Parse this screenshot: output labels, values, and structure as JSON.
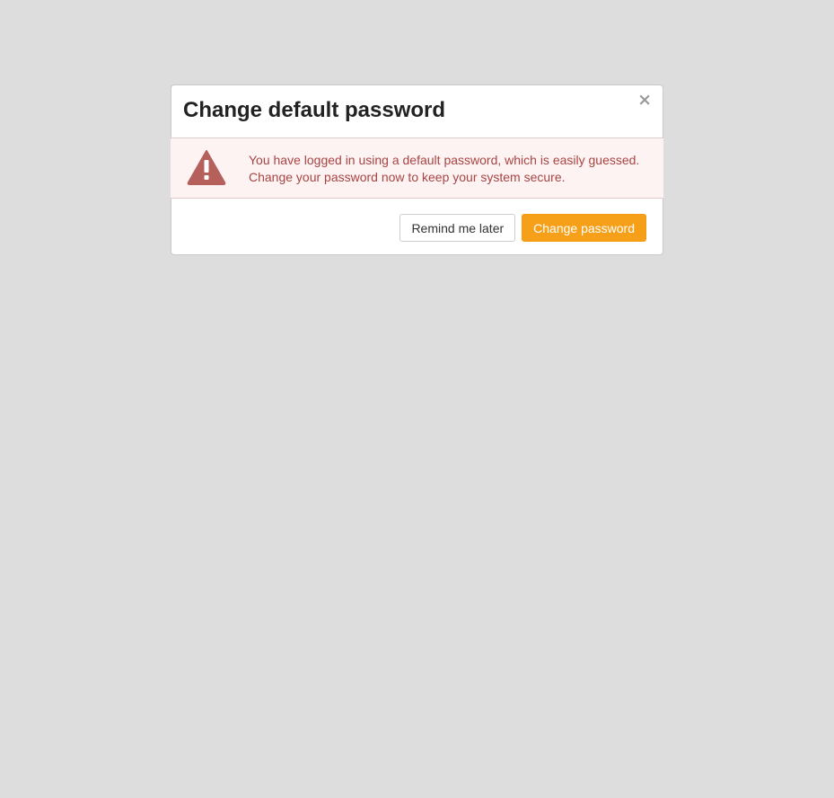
{
  "dialog": {
    "title": "Change default password",
    "close_glyph": "×",
    "alert": {
      "icon": "warning-icon",
      "line1": "You have logged in using a default password, which is easily guessed.",
      "line2": "Change your password now to keep your system secure."
    },
    "buttons": {
      "remind_label": "Remind me later",
      "change_label": "Change password"
    }
  },
  "colors": {
    "background": "#dddddd",
    "alert_bg": "#fdf3f3",
    "alert_text": "#a94442",
    "warning_icon": "#b5605a",
    "primary_button": "#f6a01a"
  }
}
